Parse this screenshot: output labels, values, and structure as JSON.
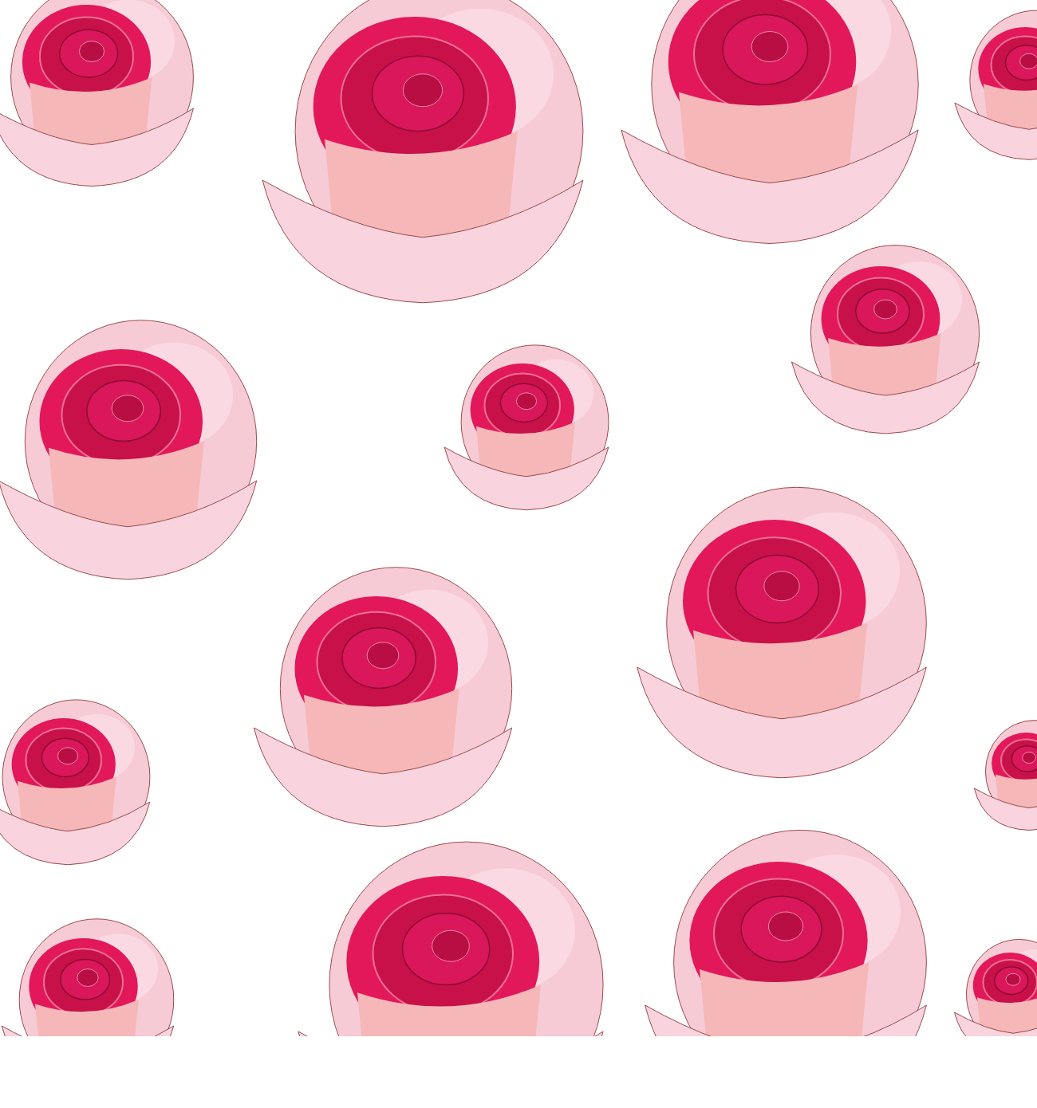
{
  "artwork": {
    "kind": "rose-pattern"
  }
}
